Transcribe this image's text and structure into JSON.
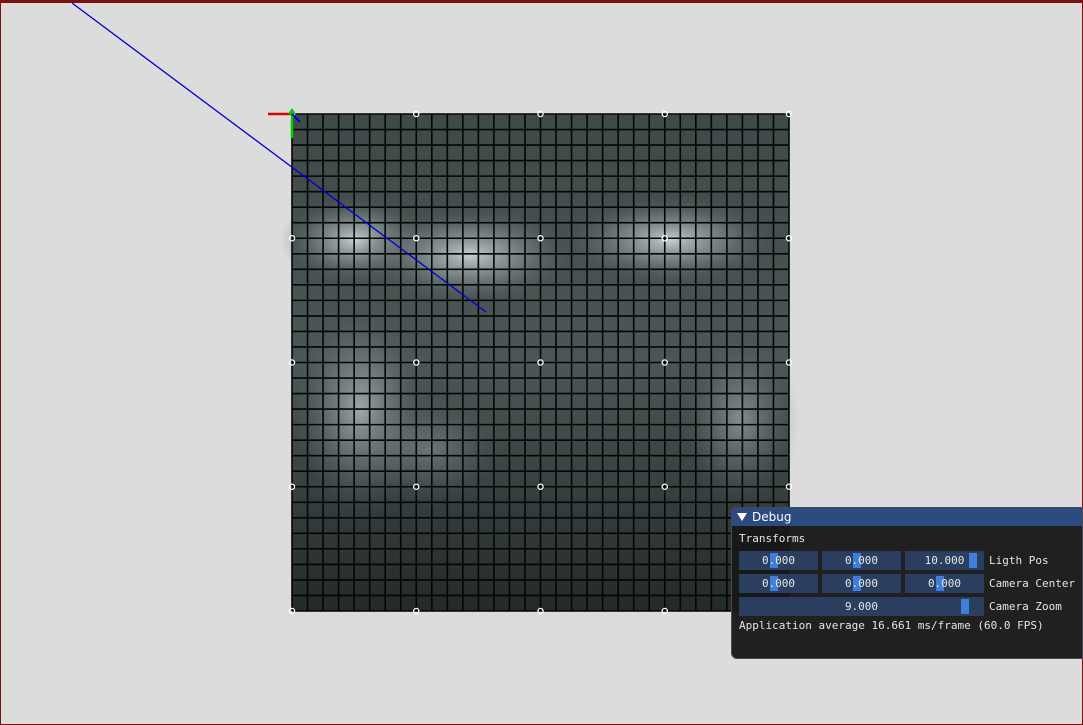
{
  "debug": {
    "title": "Debug",
    "section": "Transforms",
    "rows": [
      {
        "label": "Ligth Pos",
        "values": [
          "0.000",
          "0.000",
          "10.000"
        ],
        "fraction": [
          0.45,
          0.45,
          0.95
        ]
      },
      {
        "label": "Camera Center",
        "values": [
          "0.000",
          "0.000",
          "0.000"
        ],
        "fraction": [
          0.45,
          0.45,
          0.45
        ]
      }
    ],
    "zoom": {
      "label": "Camera Zoom",
      "value": "9.000",
      "fraction": 0.93
    },
    "status": "Application average 16.661 ms/frame (60.0 FPS)"
  },
  "scene": {
    "grid_divisions": 32,
    "handle_divisions": 4,
    "colors": {
      "background": "#dcdcdc",
      "border": "#7a1010",
      "panel_title": "#2b4a80",
      "field": "#2a3f5f",
      "accent": "#3d7fd9",
      "light_ray": "#0000cc",
      "axis_x": "#dd0000",
      "axis_y": "#00cc00"
    }
  }
}
